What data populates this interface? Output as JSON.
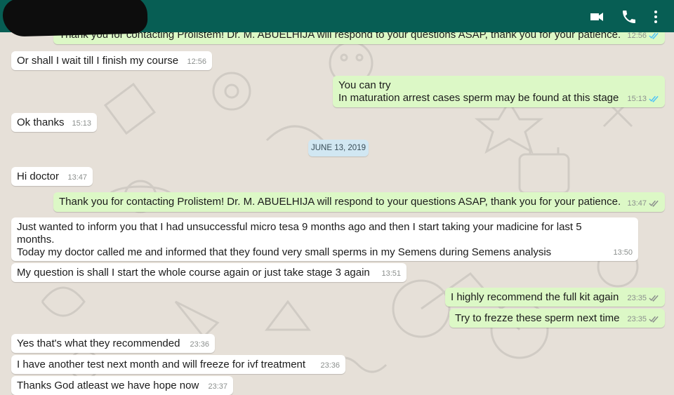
{
  "header": {
    "contact_name": "",
    "icons": [
      "video-call-icon",
      "phone-icon",
      "more-options-icon"
    ]
  },
  "date_separator": "JUNE 13, 2019",
  "messages": [
    {
      "dir": "out",
      "text": "Thank you for contacting Prolistem! Dr. M. ABUELHIJA will respond to your questions ASAP,  thank you for your patience.",
      "time": "12:56",
      "ticks": true
    },
    {
      "dir": "in",
      "text": "Or shall I wait till I finish my course",
      "time": "12:56"
    },
    {
      "dir": "out",
      "lines": [
        "You can try",
        "In maturation arrest cases sperm may be found at this stage"
      ],
      "time": "15:13",
      "ticks": true
    },
    {
      "dir": "in",
      "text": "Ok thanks",
      "time": "15:13"
    },
    {
      "dir": "in",
      "text": "Hi doctor",
      "time": "13:47"
    },
    {
      "dir": "out",
      "text": "Thank you for contacting Prolistem! Dr. M. ABUELHIJA will respond to your questions ASAP,  thank you for your patience.",
      "time": "13:47",
      "ticks": true
    },
    {
      "dir": "in",
      "lines": [
        "Just wanted to inform you that I had unsuccessful micro tesa 9 months ago and then  I start taking your madicine for last 5",
        "months.",
        "Today my doctor called me and informed that they found very small sperms in my Semens  during Semens analysis"
      ],
      "time": "13:50"
    },
    {
      "dir": "in",
      "text": "My question is shall I start the whole course again or just take stage 3 again",
      "time": "13:51"
    },
    {
      "dir": "out",
      "text": "I highly recommend the full kit again",
      "time": "23:35",
      "ticks": true
    },
    {
      "dir": "out",
      "text": "Try to frezze these sperm next time",
      "time": "23:35",
      "ticks": true
    },
    {
      "dir": "in",
      "text": "Yes that's what they recommended",
      "time": "23:36"
    },
    {
      "dir": "in",
      "text": "I have another test next month and will freeze for ivf treatment",
      "time": "23:36"
    },
    {
      "dir": "in",
      "text": "Thanks God atleast we have hope now",
      "time": "23:37"
    }
  ],
  "colors": {
    "header": "#075e54",
    "incoming_bubble": "#ffffff",
    "outgoing_bubble": "#dcf8c6",
    "read_ticks": "#4fc3f7",
    "date_chip": "#d1e7f2"
  }
}
